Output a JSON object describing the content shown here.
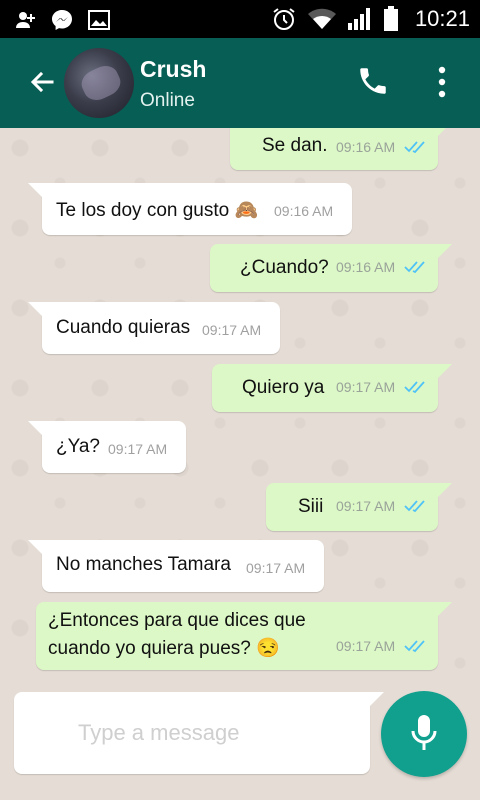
{
  "status_bar": {
    "time": "10:21"
  },
  "header": {
    "contact_name": "Crush",
    "contact_status": "Online"
  },
  "messages": [
    {
      "direction": "out",
      "text": "Se dan.",
      "time": "09:16 AM",
      "read": true
    },
    {
      "direction": "in",
      "text": "Te los doy con gusto 🙈",
      "time": "09:16 AM"
    },
    {
      "direction": "out",
      "text": "¿Cuando?",
      "time": "09:16 AM",
      "read": true
    },
    {
      "direction": "in",
      "text": "Cuando quieras",
      "time": "09:17 AM"
    },
    {
      "direction": "out",
      "text": "Quiero ya",
      "time": "09:17 AM",
      "read": true
    },
    {
      "direction": "in",
      "text": "¿Ya?",
      "time": "09:17 AM"
    },
    {
      "direction": "out",
      "text": "Siii",
      "time": "09:17 AM",
      "read": true
    },
    {
      "direction": "in",
      "text": "No manches Tamara",
      "time": "09:17 AM"
    },
    {
      "direction": "out",
      "text_line1": "¿Entonces para que dices que",
      "text_line2": "cuando yo quiera pues? 😒",
      "time": "09:17 AM",
      "read": true
    }
  ],
  "composer": {
    "placeholder": "Type a message"
  },
  "colors": {
    "header": "#075e54",
    "outgoing_bubble": "#dcf8c6",
    "incoming_bubble": "#ffffff",
    "mic_button": "#119f8e",
    "read_ticks": "#4fc3f7"
  },
  "icons": {
    "back": "arrow-left-icon",
    "call": "phone-icon",
    "more": "more-vert-icon",
    "mic": "mic-icon"
  }
}
